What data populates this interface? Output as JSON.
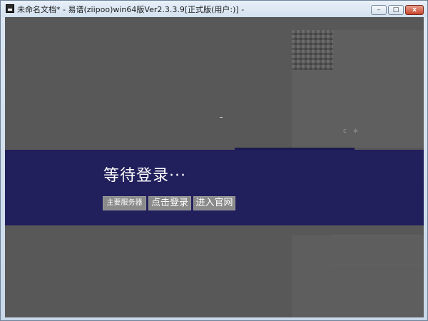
{
  "window": {
    "title": "未命名文档* - 易谱(ziipoo)win64版Ver2.3.3.9[正式版(用户:)] -",
    "controls": {
      "minimize": "–",
      "maximize": "□",
      "close": "x"
    }
  },
  "overlay": {
    "title": "等待登录···",
    "buttons": {
      "server": "主要服务器",
      "login": "点击登录",
      "website": "进入官网"
    },
    "colors": {
      "banner": "#211f5c",
      "button": "#8a8a8a",
      "backdrop": "#585858"
    }
  }
}
